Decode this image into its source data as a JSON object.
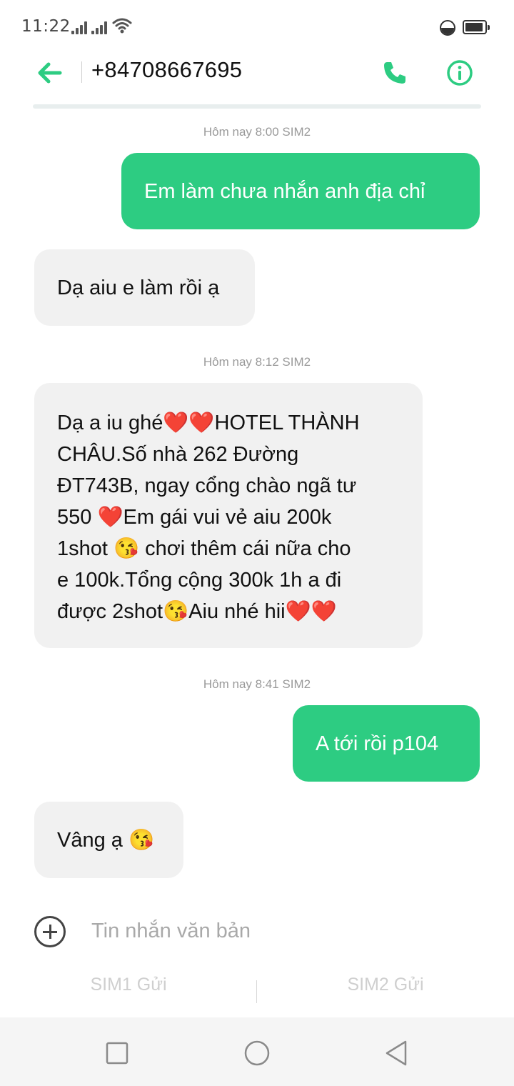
{
  "status_bar": {
    "time": "11:22",
    "icons": [
      "signal-icon",
      "signal-icon",
      "wifi-icon",
      "do-not-disturb-icon",
      "battery-icon"
    ]
  },
  "header": {
    "contact": "+84708667695",
    "back_icon": "arrow-left-icon",
    "call_icon": "phone-icon",
    "info_icon": "info-icon",
    "accent_color": "#2dcc82"
  },
  "messages": [
    {
      "type": "timestamp",
      "text": "Hôm nay 8:00  SIM2"
    },
    {
      "type": "outgoing",
      "text": "Em làm chưa nhắn anh địa chỉ"
    },
    {
      "type": "incoming",
      "text": "Dạ aiu e làm rồi ạ"
    },
    {
      "type": "timestamp",
      "text": "Hôm nay 8:12  SIM2"
    },
    {
      "type": "incoming",
      "lines": [
        "Dạ a iu ghé❤️❤️HOTEL THÀNH",
        "CHÂU.Số nhà 262 Đường",
        "ĐT743B, ngay cổng chào ngã tư",
        "550 ❤️Em gái vui vẻ aiu 200k",
        "1shot 😘 chơi thêm cái nữa cho",
        "e 100k.Tổng cộng 300k 1h a đi",
        "được 2shot😘Aiu nhé hii❤️❤️"
      ]
    },
    {
      "type": "timestamp",
      "text": "Hôm nay 8:41  SIM2"
    },
    {
      "type": "outgoing",
      "text": "A tới rồi p104"
    },
    {
      "type": "incoming",
      "text": "Vâng ạ 😘"
    }
  ],
  "composer": {
    "placeholder": "Tin nhắn văn bản",
    "add_icon": "plus-circle-icon",
    "send_sim1": "SIM1 Gửi",
    "send_sim2": "SIM2 Gửi"
  },
  "nav_bar": {
    "icons": [
      "square-icon",
      "circle-icon",
      "triangle-back-icon"
    ]
  },
  "colors": {
    "outgoing_bubble": "#2dcc82",
    "incoming_bubble": "#f1f1f1"
  }
}
